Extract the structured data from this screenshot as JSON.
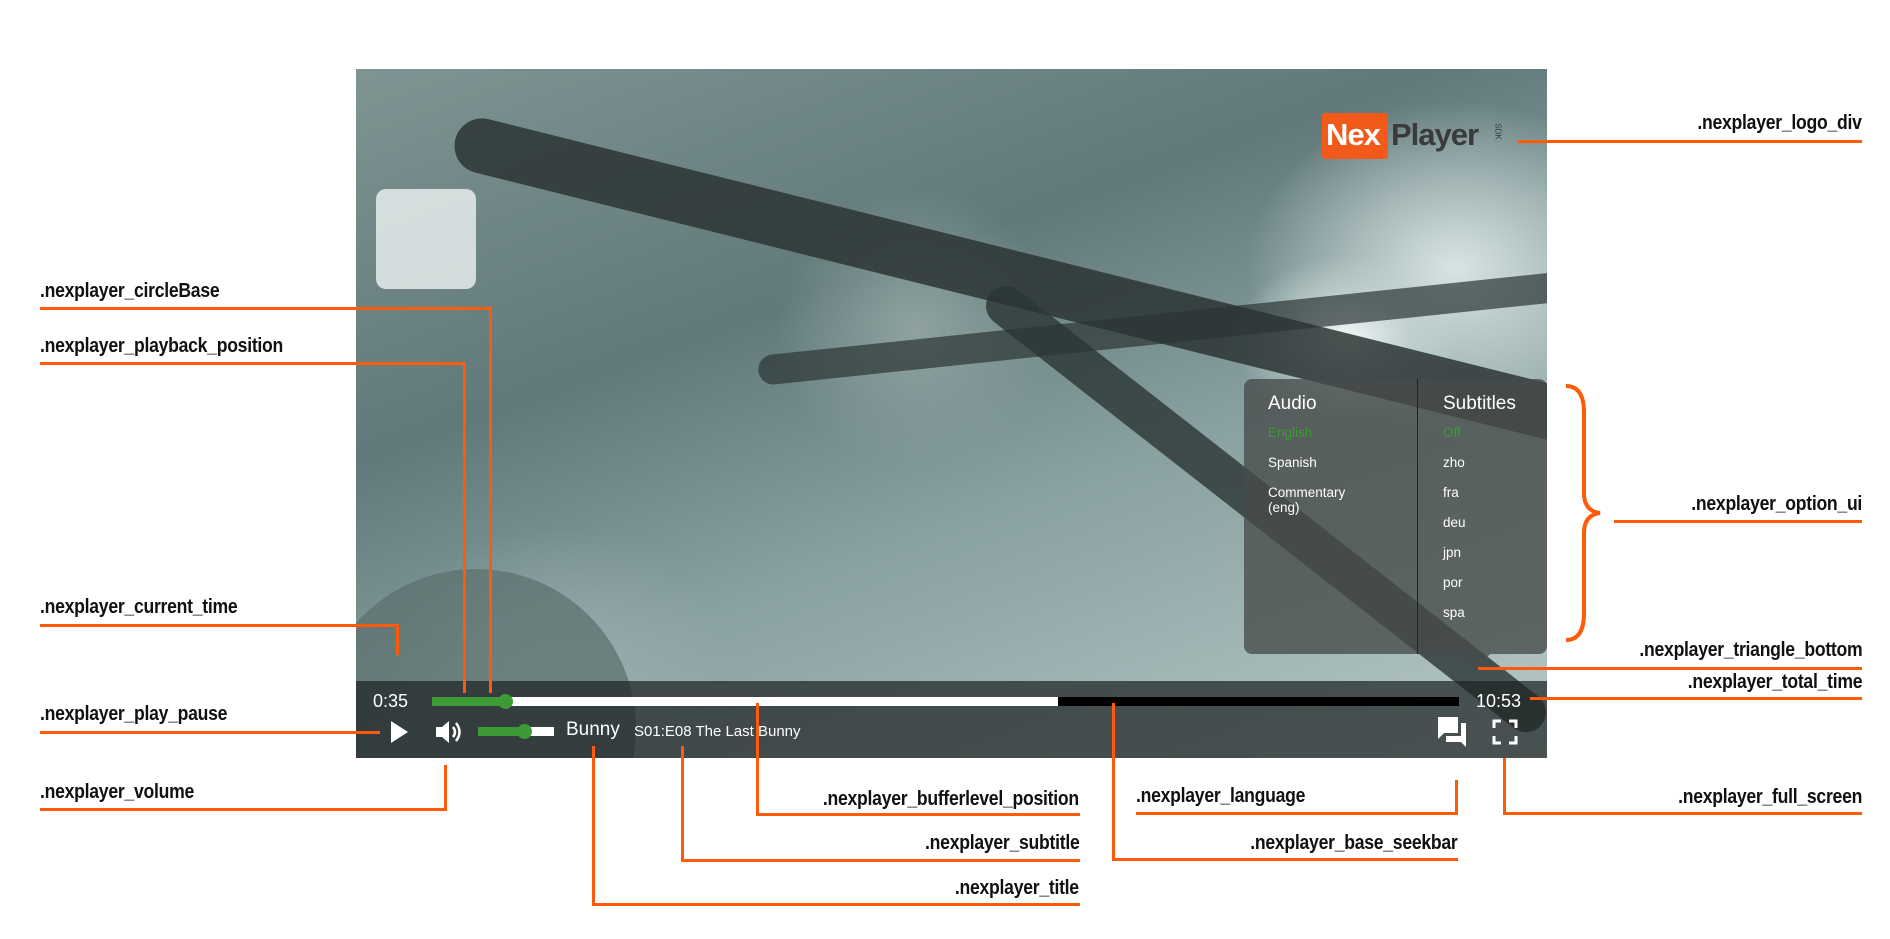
{
  "player": {
    "current_time": "0:35",
    "total_time": "10:53",
    "playback_fraction": 0.071,
    "buffer_fraction": 0.61,
    "volume_fraction": 0.6,
    "title": "Bunny",
    "subtitle": "S01:E08 The Last Bunny",
    "logo_text": "NexPlayer SDK",
    "accent_color": "#3d9b35",
    "icons": {
      "play": "play-icon",
      "volume": "volume-icon",
      "language": "chat-bubbles-icon",
      "fullscreen": "fullscreen-icon"
    }
  },
  "options": {
    "audio_header": "Audio",
    "audio_items": [
      {
        "label": "English",
        "selected": true
      },
      {
        "label": "Spanish",
        "selected": false
      },
      {
        "label": "Commentary (eng)",
        "selected": false
      }
    ],
    "subtitles_header": "Subtitles",
    "subtitle_items": [
      {
        "label": "Off",
        "selected": true
      },
      {
        "label": "zho"
      },
      {
        "label": "fra"
      },
      {
        "label": "deu"
      },
      {
        "label": "jpn"
      },
      {
        "label": "por"
      },
      {
        "label": "spa"
      }
    ]
  },
  "annotations": {
    "circle_base": ".nexplayer_circleBase",
    "playback_position": ".nexplayer_playback_position",
    "current_time": ".nexplayer_current_time",
    "play_pause": ".nexplayer_play_pause",
    "volume": ".nexplayer_volume",
    "logo_div": ".nexplayer_logo_div",
    "option_ui": ".nexplayer_option_ui",
    "triangle_bottom": ".nexplayer_triangle_bottom",
    "total_time": ".nexplayer_total_time",
    "full_screen": ".nexplayer_full_screen",
    "language": ".nexplayer_language",
    "base_seekbar": ".nexplayer_base_seekbar",
    "bufferlevel_position": ".nexplayer_bufferlevel_position",
    "subtitle": ".nexplayer_subtitle",
    "title": ".nexplayer_title"
  },
  "accent_annotation_color": "#ff5a0a"
}
